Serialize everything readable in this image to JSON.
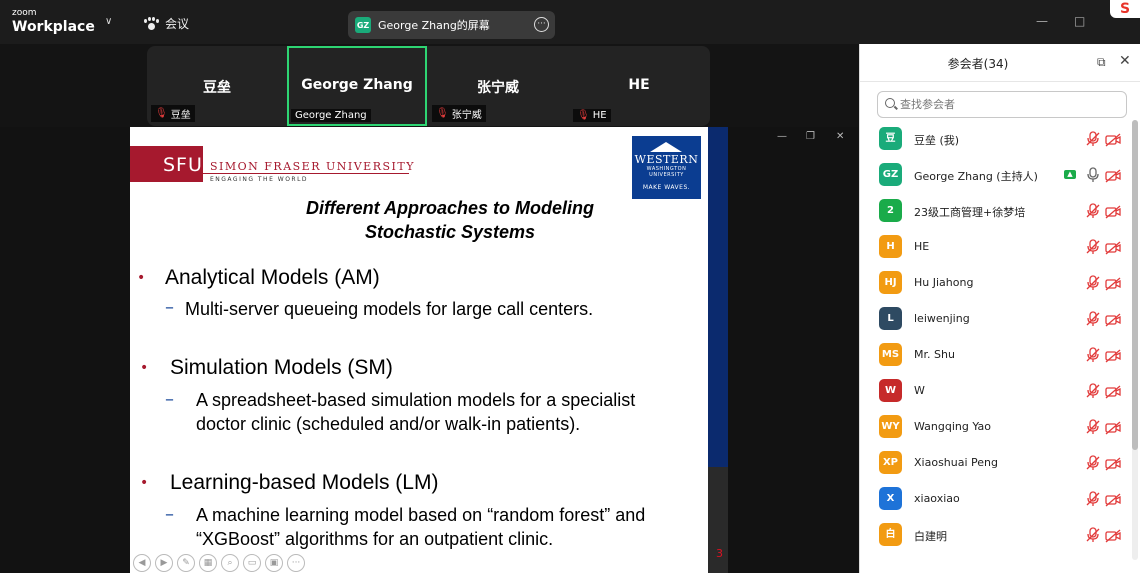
{
  "app": {
    "logo_top": "zoom",
    "logo_main": "Workplace",
    "meeting_label": "会议"
  },
  "share_pill": {
    "badge": "GZ",
    "title": "George Zhang的屏幕"
  },
  "video_tiles": [
    {
      "display": "豆垒",
      "label": "豆垒",
      "muted": true,
      "active": false
    },
    {
      "display": "George Zhang",
      "label": "George Zhang",
      "muted": false,
      "active": true
    },
    {
      "display": "张宁威",
      "label": "张宁威",
      "muted": true,
      "active": false
    },
    {
      "display": "HE",
      "label": "HE",
      "muted": true,
      "active": false
    }
  ],
  "slide": {
    "sfu_mark": "SFU",
    "sfu_name": "SIMON FRASER UNIVERSITY",
    "sfu_tagline": "ENGAGING THE WORLD",
    "wwu_line1": "WESTERN",
    "wwu_line2": "WASHINGTON",
    "wwu_line3": "UNIVERSITY",
    "wwu_tagline": "MAKE WAVES.",
    "title_line1": "Different Approaches to Modeling",
    "title_line2": "Stochastic Systems",
    "bullets": [
      {
        "heading": "Analytical Models (AM)",
        "sub1": "Multi-server queueing models for large call centers.",
        "sub2": ""
      },
      {
        "heading": "Simulation Models (SM)",
        "sub1": "A spreadsheet-based simulation models for a specialist",
        "sub2": "doctor clinic (scheduled and/or walk-in patients)."
      },
      {
        "heading": "Learning-based Models (LM)",
        "sub1": "A machine learning model based on “random forest” and",
        "sub2": "“XGBoost” algorithms for an outpatient clinic."
      }
    ],
    "page_number": "3"
  },
  "panel": {
    "title": "参会者(34)",
    "search_placeholder": "查找参会者",
    "participants": [
      {
        "initials": "豆",
        "name": "豆垒 (我)",
        "color": "#1aab7a",
        "sharing": false,
        "mic_on": false
      },
      {
        "initials": "GZ",
        "name": "George Zhang (主持人)",
        "color": "#1aab7a",
        "sharing": true,
        "mic_on": true
      },
      {
        "initials": "2",
        "name": "23级工商管理+徐梦培",
        "color": "#1aab4a",
        "sharing": false,
        "mic_on": false
      },
      {
        "initials": "H",
        "name": "HE",
        "color": "#f29b12",
        "sharing": false,
        "mic_on": false
      },
      {
        "initials": "HJ",
        "name": "Hu Jiahong",
        "color": "#f29b12",
        "sharing": false,
        "mic_on": false
      },
      {
        "initials": "L",
        "name": "leiwenjing",
        "color": "#2e4a62",
        "sharing": false,
        "mic_on": false
      },
      {
        "initials": "MS",
        "name": "Mr. Shu",
        "color": "#f29b12",
        "sharing": false,
        "mic_on": false
      },
      {
        "initials": "W",
        "name": "W",
        "color": "#c62a2a",
        "sharing": false,
        "mic_on": false
      },
      {
        "initials": "WY",
        "name": "Wangqing Yao",
        "color": "#f29b12",
        "sharing": false,
        "mic_on": false
      },
      {
        "initials": "XP",
        "name": "Xiaoshuai Peng",
        "color": "#f29b12",
        "sharing": false,
        "mic_on": false
      },
      {
        "initials": "X",
        "name": "xiaoxiao",
        "color": "#1e73d8",
        "sharing": false,
        "mic_on": false
      },
      {
        "initials": "白",
        "name": "白建明",
        "color": "#f29b12",
        "sharing": false,
        "mic_on": false
      }
    ]
  }
}
